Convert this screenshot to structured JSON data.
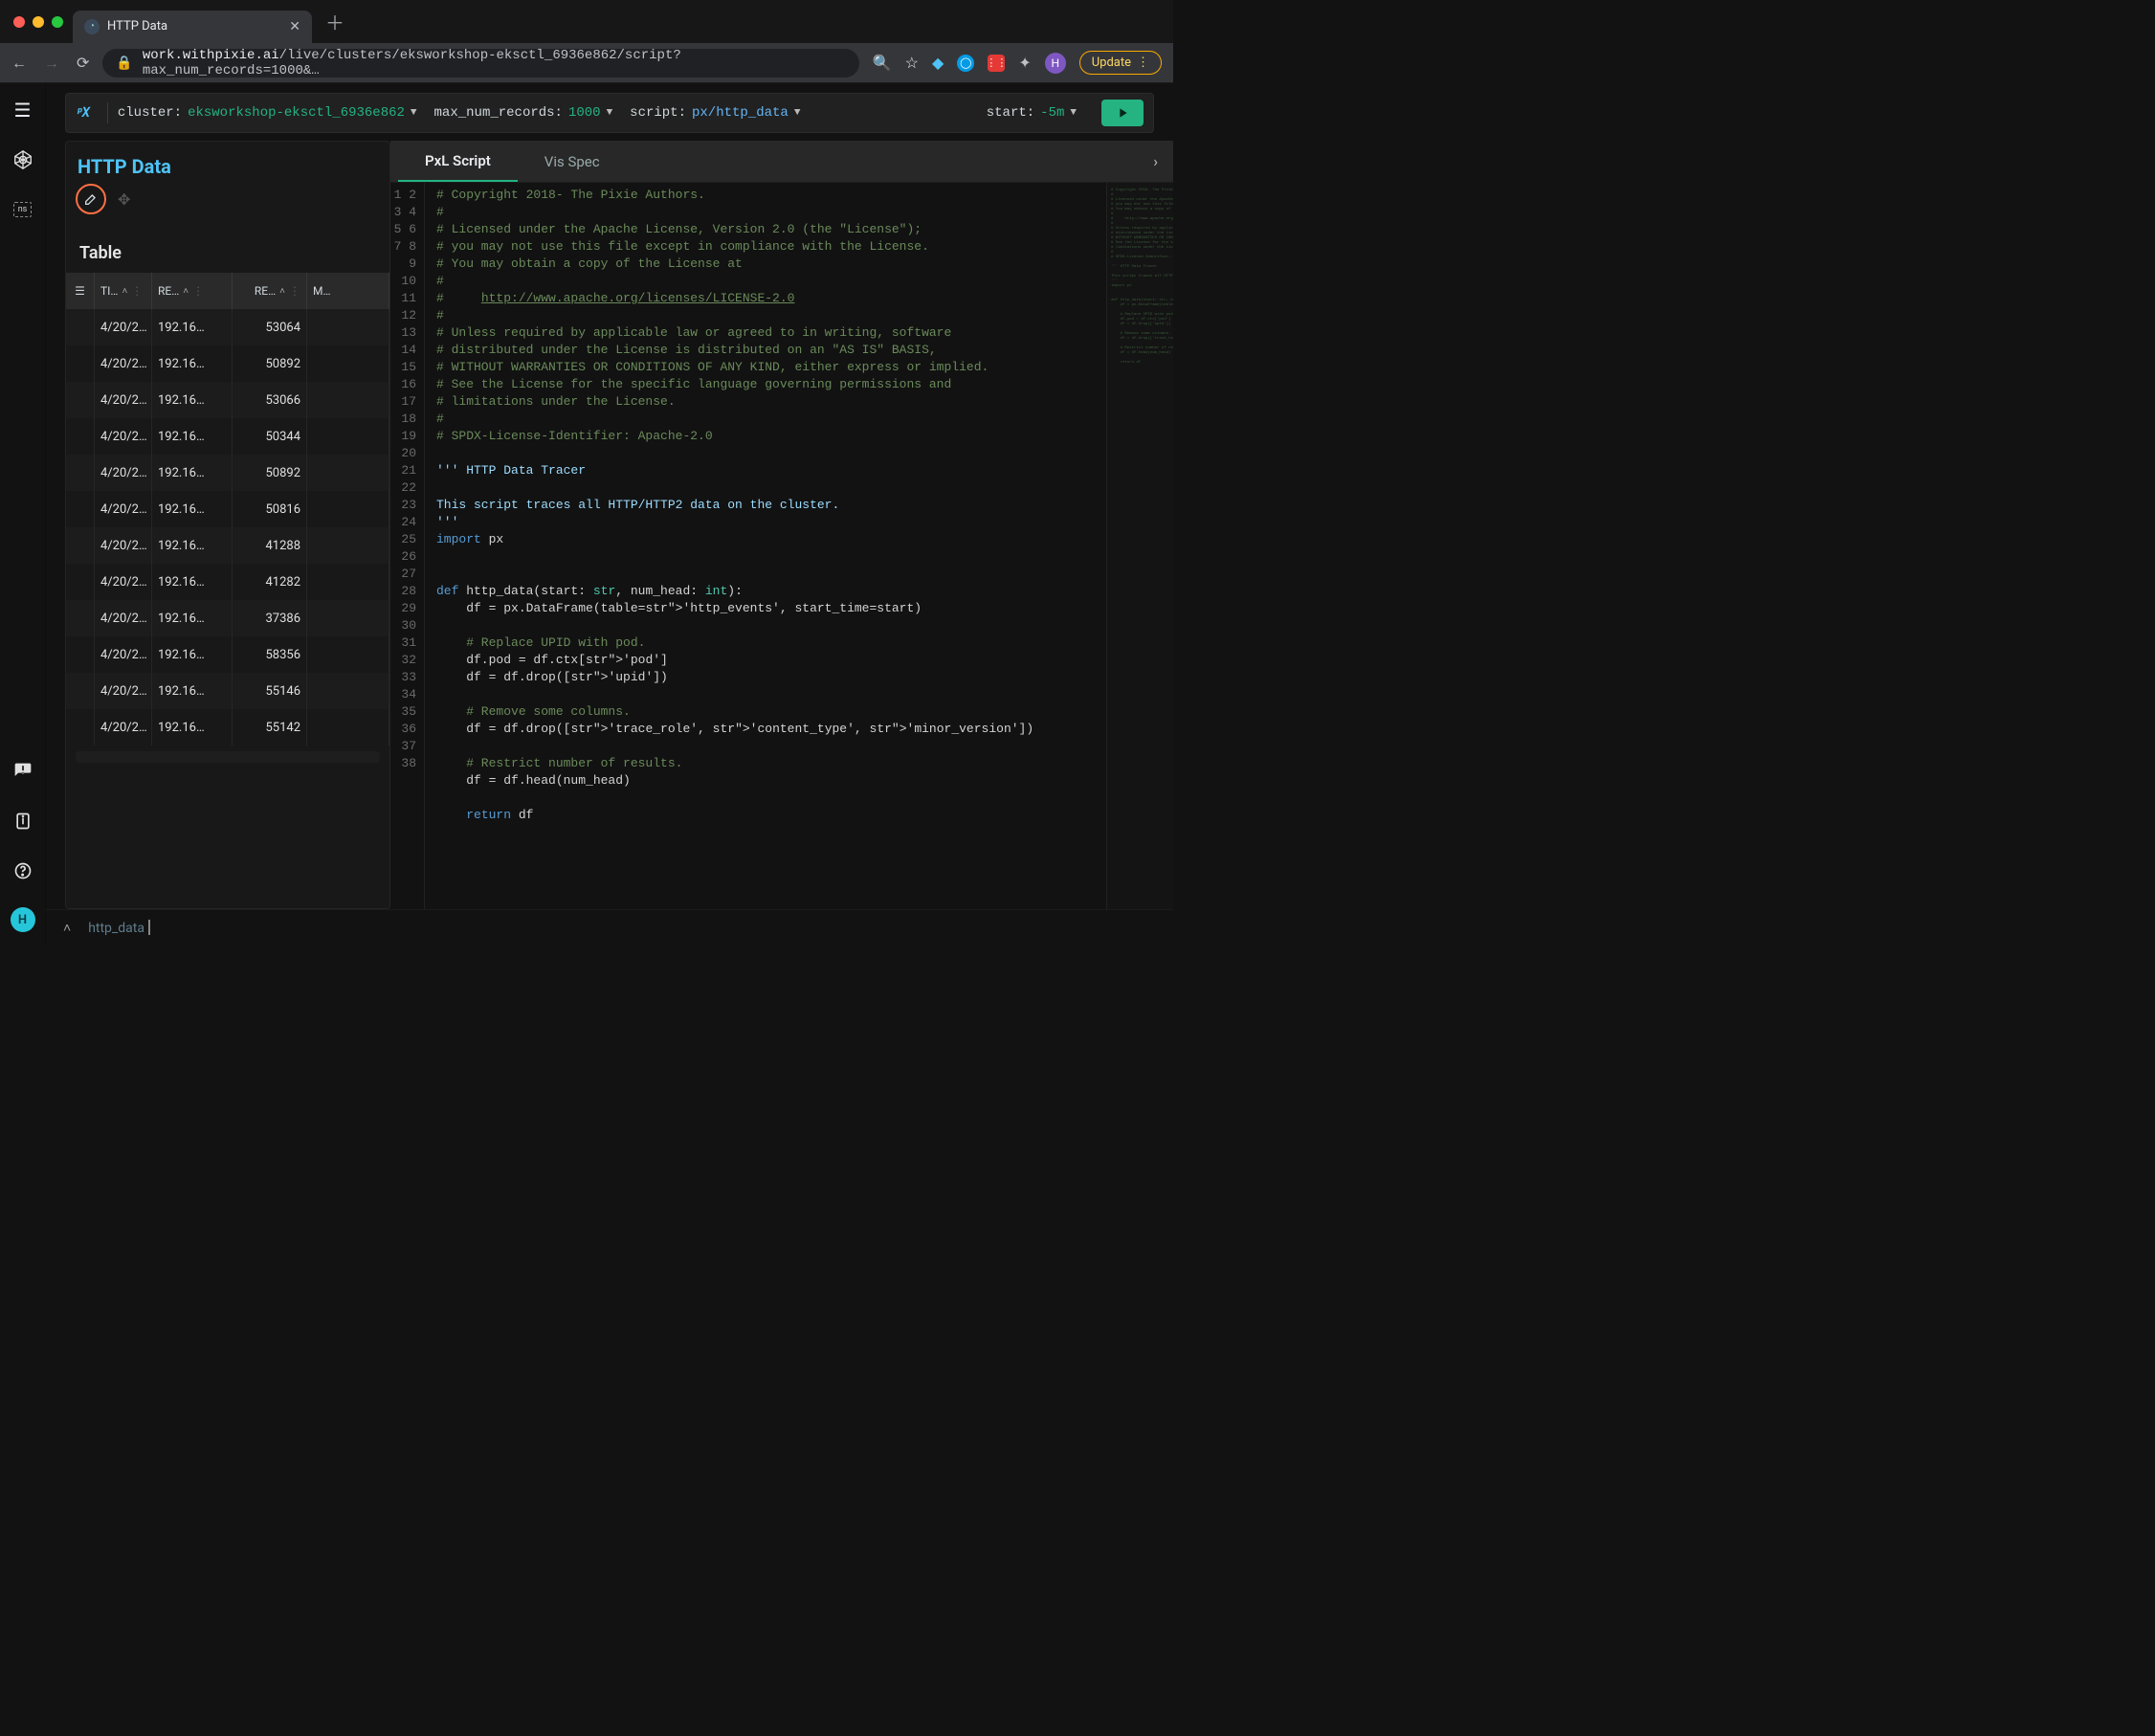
{
  "browser": {
    "tab_title": "HTTP Data",
    "url_domain": "work.withpixie.ai",
    "url_path": "/live/clusters/eksworkshop-eksctl_6936e862/script?max_num_records=1000&…",
    "update_label": "Update",
    "avatar_letter": "H"
  },
  "sidebar": {
    "ns_label": "ns",
    "avatar_letter": "H"
  },
  "params": {
    "cluster_label": "cluster:",
    "cluster_value": "eksworkshop-eksctl_6936e862",
    "max_label": "max_num_records:",
    "max_value": "1000",
    "script_label": "script:",
    "script_value": "px/http_data",
    "start_label": "start:",
    "start_value": "-5m"
  },
  "panel": {
    "title": "HTTP Data",
    "table_label": "Table",
    "columns": {
      "menu": "",
      "ti": "TI…",
      "re1": "RE…",
      "re2": "RE…",
      "ma": "M…"
    },
    "rows": [
      {
        "ti": "4/20/2…",
        "re1": "192.16…",
        "re2": "53064"
      },
      {
        "ti": "4/20/2…",
        "re1": "192.16…",
        "re2": "50892"
      },
      {
        "ti": "4/20/2…",
        "re1": "192.16…",
        "re2": "53066"
      },
      {
        "ti": "4/20/2…",
        "re1": "192.16…",
        "re2": "50344"
      },
      {
        "ti": "4/20/2…",
        "re1": "192.16…",
        "re2": "50892"
      },
      {
        "ti": "4/20/2…",
        "re1": "192.16…",
        "re2": "50816"
      },
      {
        "ti": "4/20/2…",
        "re1": "192.16…",
        "re2": "41288"
      },
      {
        "ti": "4/20/2…",
        "re1": "192.16…",
        "re2": "41282"
      },
      {
        "ti": "4/20/2…",
        "re1": "192.16…",
        "re2": "37386"
      },
      {
        "ti": "4/20/2…",
        "re1": "192.16…",
        "re2": "58356"
      },
      {
        "ti": "4/20/2…",
        "re1": "192.16…",
        "re2": "55146"
      },
      {
        "ti": "4/20/2…",
        "re1": "192.16…",
        "re2": "55142"
      }
    ]
  },
  "editor": {
    "tab_pxl": "PxL Script",
    "tab_vis": "Vis Spec",
    "lines": [
      "# Copyright 2018- The Pixie Authors.",
      "#",
      "# Licensed under the Apache License, Version 2.0 (the \"License\");",
      "# you may not use this file except in compliance with the License.",
      "# You may obtain a copy of the License at",
      "#",
      "#     http://www.apache.org/licenses/LICENSE-2.0",
      "#",
      "# Unless required by applicable law or agreed to in writing, software",
      "# distributed under the License is distributed on an \"AS IS\" BASIS,",
      "# WITHOUT WARRANTIES OR CONDITIONS OF ANY KIND, either express or implied.",
      "# See the License for the specific language governing permissions and",
      "# limitations under the License.",
      "#",
      "# SPDX-License-Identifier: Apache-2.0",
      "",
      "''' HTTP Data Tracer",
      "",
      "This script traces all HTTP/HTTP2 data on the cluster.",
      "'''",
      "import px",
      "",
      "",
      "def http_data(start: str, num_head: int):",
      "    df = px.DataFrame(table='http_events', start_time=start)",
      "",
      "    # Replace UPID with pod.",
      "    df.pod = df.ctx['pod']",
      "    df = df.drop(['upid'])",
      "",
      "    # Remove some columns.",
      "    df = df.drop(['trace_role', 'content_type', 'minor_version'])",
      "",
      "    # Restrict number of results.",
      "    df = df.head(num_head)",
      "",
      "    return df",
      ""
    ]
  },
  "bottom": {
    "script_name": "http_data"
  }
}
